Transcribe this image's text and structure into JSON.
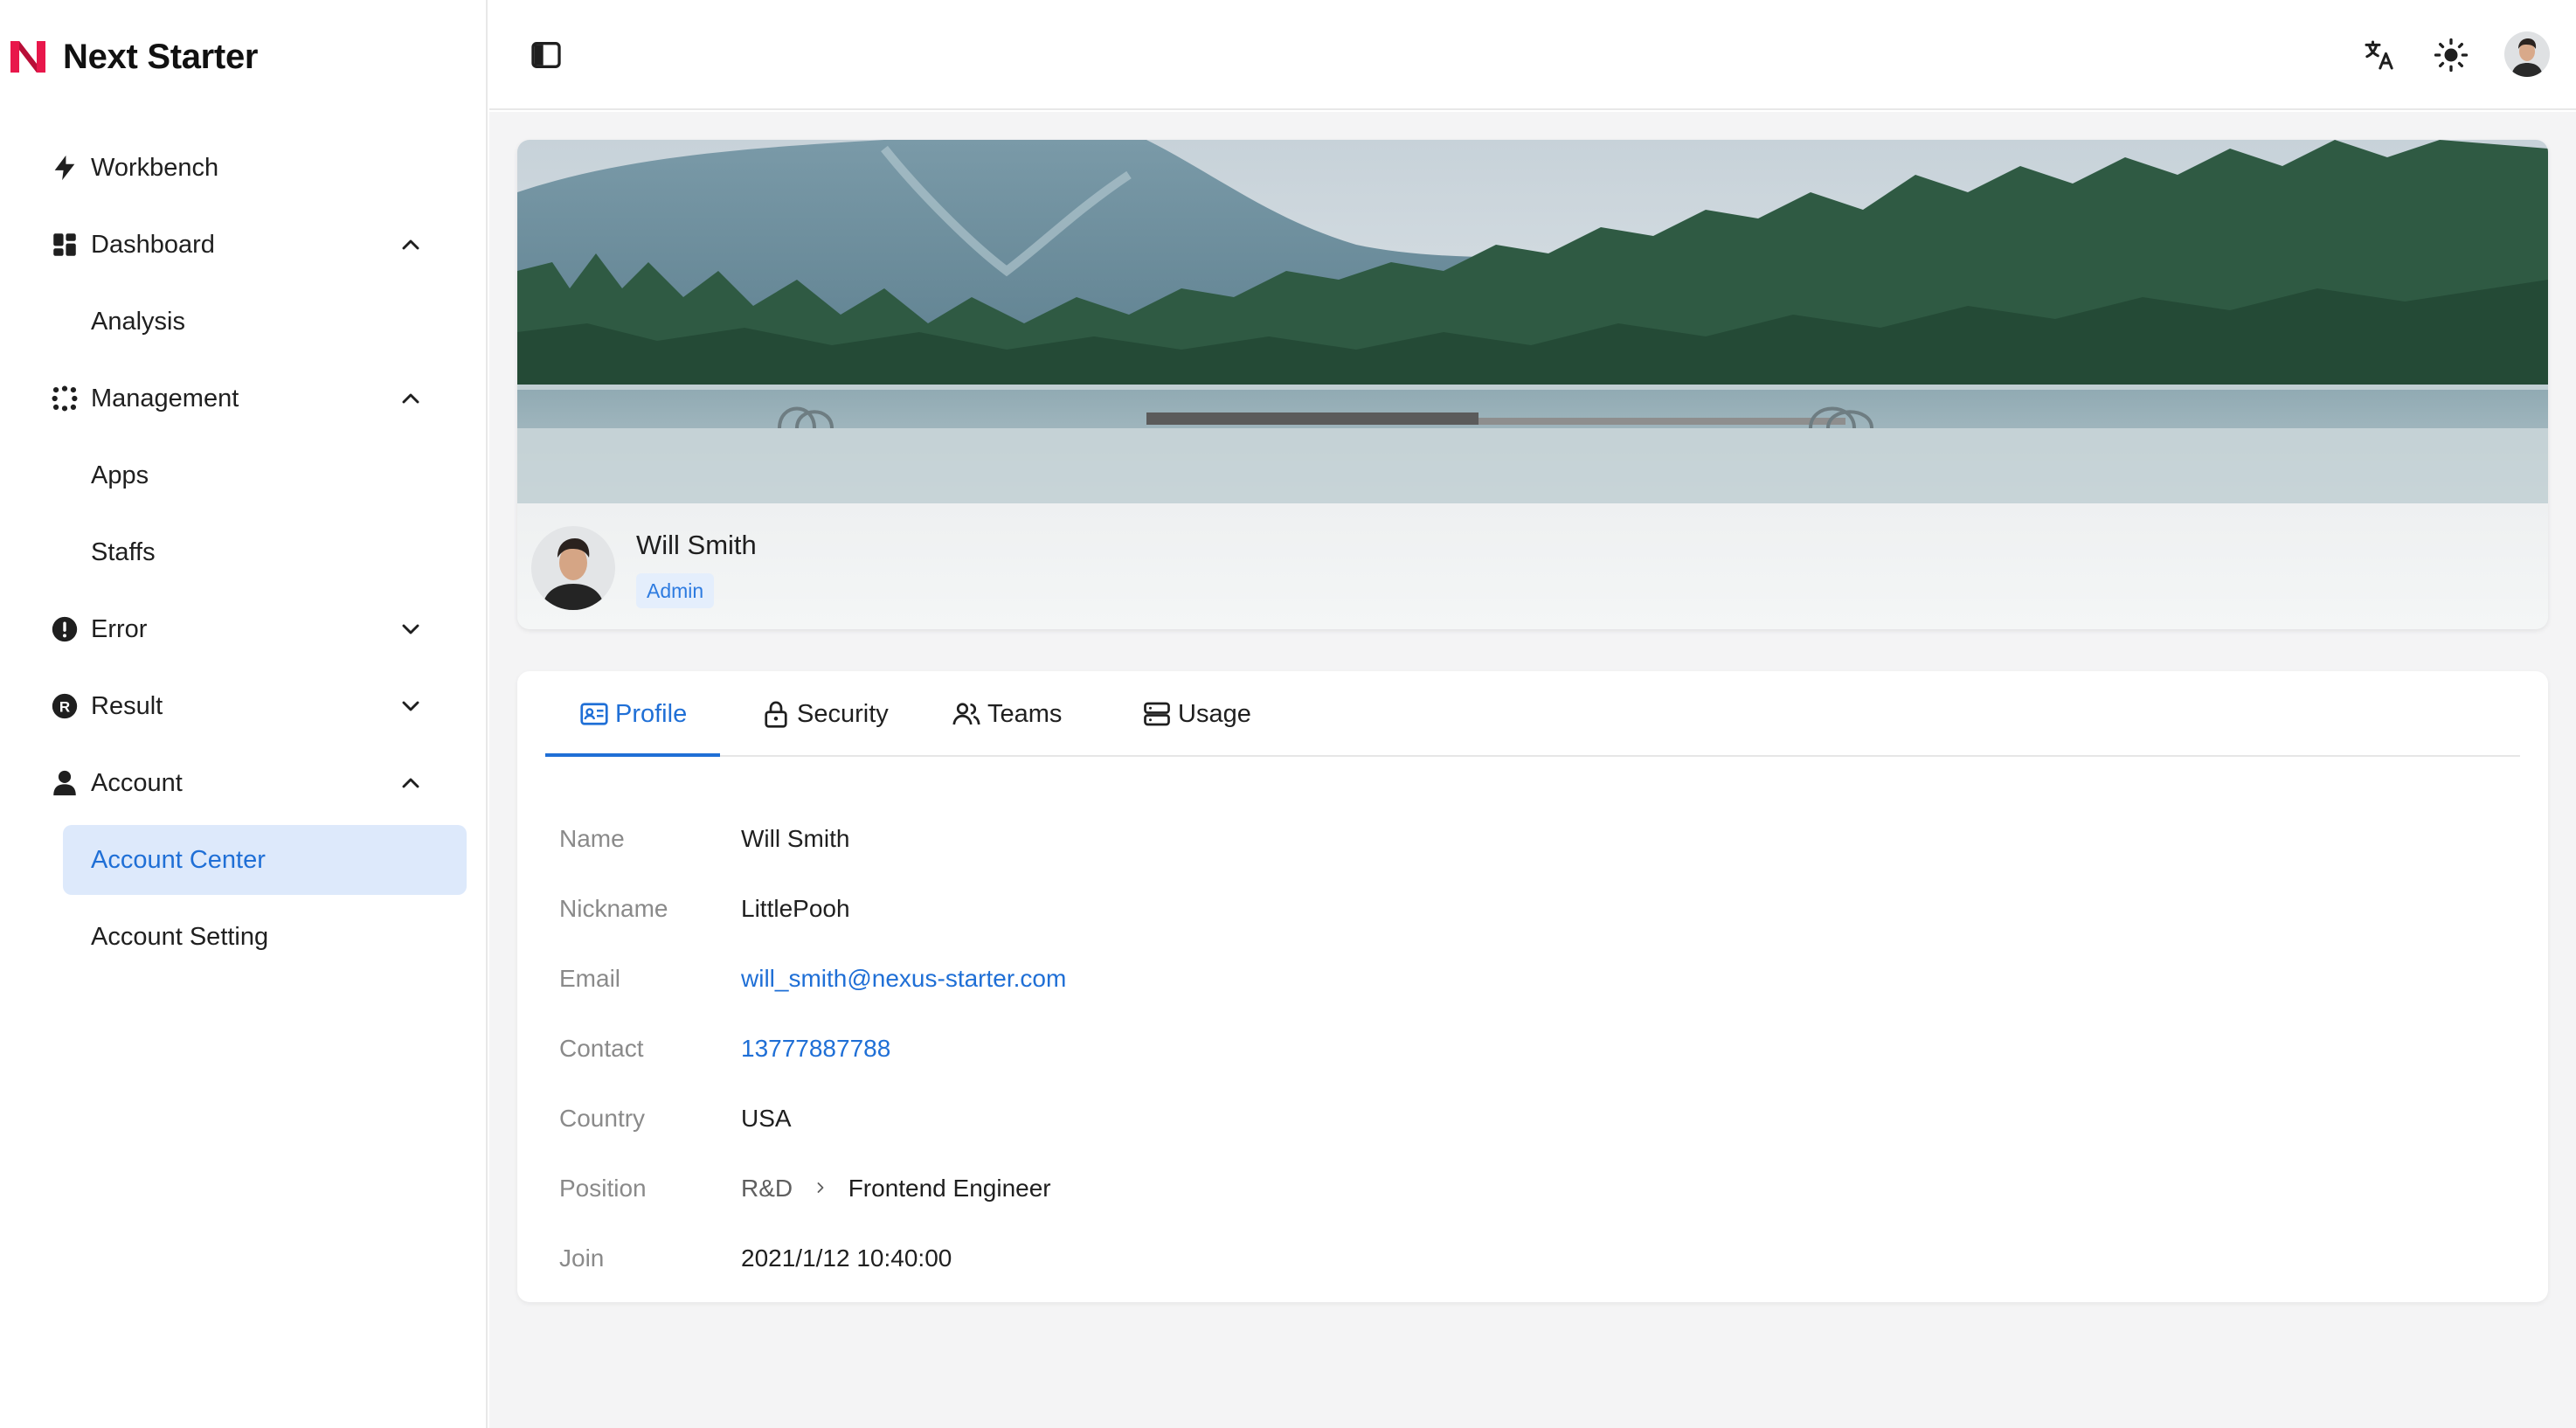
{
  "brand": {
    "name": "Next Starter",
    "accent": "#e8174b"
  },
  "sidebar": {
    "items": [
      {
        "label": "Workbench",
        "icon": "lightning-icon"
      },
      {
        "label": "Dashboard",
        "icon": "dashboard-icon",
        "expanded": true,
        "children": [
          {
            "label": "Analysis"
          }
        ]
      },
      {
        "label": "Management",
        "icon": "dots-grid-icon",
        "expanded": true,
        "children": [
          {
            "label": "Apps"
          },
          {
            "label": "Staffs"
          }
        ]
      },
      {
        "label": "Error",
        "icon": "exclamation-circle-icon",
        "expanded": false
      },
      {
        "label": "Result",
        "icon": "r-circle-icon",
        "expanded": false
      },
      {
        "label": "Account",
        "icon": "user-icon",
        "expanded": true,
        "children": [
          {
            "label": "Account Center",
            "active": true
          },
          {
            "label": "Account Setting"
          }
        ]
      }
    ]
  },
  "header": {
    "icons": [
      "sidebar-toggle-icon",
      "translate-icon",
      "sun-icon",
      "avatar"
    ]
  },
  "profile": {
    "name": "Will Smith",
    "role": "Admin"
  },
  "tabs": [
    {
      "label": "Profile",
      "icon": "id-card-icon",
      "active": true
    },
    {
      "label": "Security",
      "icon": "lock-icon"
    },
    {
      "label": "Teams",
      "icon": "users-icon"
    },
    {
      "label": "Usage",
      "icon": "database-icon"
    }
  ],
  "details": {
    "name": {
      "label": "Name",
      "value": "Will Smith"
    },
    "nickname": {
      "label": "Nickname",
      "value": "LittlePooh"
    },
    "email": {
      "label": "Email",
      "value": "will_smith@nexus-starter.com"
    },
    "contact": {
      "label": "Contact",
      "value": "13777887788"
    },
    "country": {
      "label": "Country",
      "value": "USA"
    },
    "position": {
      "label": "Position",
      "department": "R&D",
      "title": "Frontend Engineer"
    },
    "join": {
      "label": "Join",
      "value": "2021/1/12 10:40:00"
    }
  },
  "colors": {
    "primary": "#1f6fd6",
    "active_bg": "#dde9fb",
    "page_bg": "#f4f4f5"
  }
}
